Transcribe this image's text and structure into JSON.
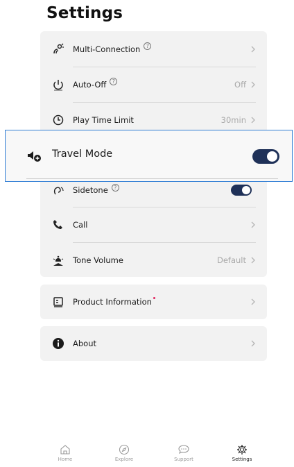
{
  "page": {
    "title": "Settings"
  },
  "settings_list": [
    {
      "label": "Multi-Connection",
      "help": "?",
      "value": ""
    },
    {
      "label": "Auto-Off",
      "help": "?",
      "value": "Off"
    },
    {
      "label": "Play Time Limit",
      "value": "30min"
    },
    {
      "label": "Sidetone",
      "help": "?",
      "toggle_on": true
    },
    {
      "label": "Call",
      "value": ""
    },
    {
      "label": "Tone Volume",
      "value": "Default"
    }
  ],
  "highlight": {
    "label": "Travel Mode",
    "toggle_on": true
  },
  "product_info": {
    "label": "Product Information",
    "has_notification": true
  },
  "about": {
    "label": "About"
  },
  "bottom_nav": [
    {
      "label": "Home",
      "icon": "home-icon",
      "active": false
    },
    {
      "label": "Explore",
      "icon": "compass-icon",
      "active": false
    },
    {
      "label": "Support",
      "icon": "chat-icon",
      "active": false
    },
    {
      "label": "Settings",
      "icon": "gear-icon",
      "active": true
    }
  ],
  "colors": {
    "toggle_on": "#1f3158",
    "highlight_border": "#2f7dd4",
    "notification_dot": "#e0245e"
  }
}
